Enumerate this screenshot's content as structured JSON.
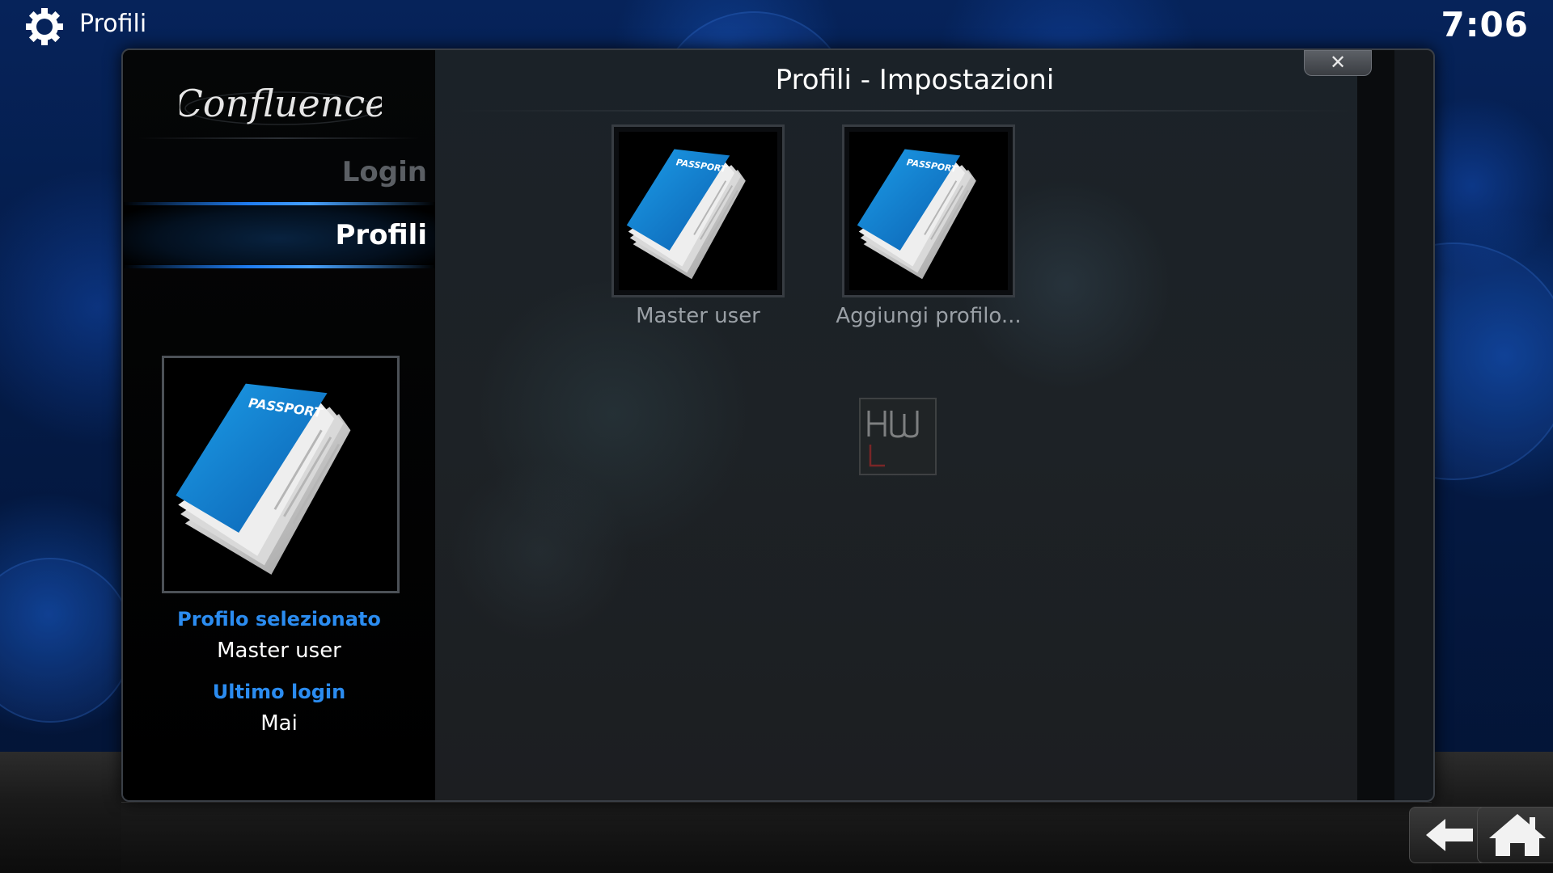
{
  "topbar": {
    "title": "Profili",
    "clock": "7:06",
    "icon": "gear-icon"
  },
  "dialog": {
    "title": "Profili - Impostazioni",
    "close_label": "✕",
    "logo_text": "Confluence"
  },
  "sidebar": {
    "items": [
      {
        "label": "Login",
        "selected": false
      },
      {
        "label": "Profili",
        "selected": true
      }
    ]
  },
  "profile_info": {
    "selected_label": "Profilo selezionato",
    "selected_value": "Master user",
    "last_login_label": "Ultimo login",
    "last_login_value": "Mai"
  },
  "profiles": [
    {
      "name": "Master user",
      "icon": "passport-icon"
    },
    {
      "name": "Aggiungi profilo...",
      "icon": "passport-icon"
    }
  ],
  "passport_text": "PASSPORT",
  "nav": {
    "back_icon": "back-arrow-icon",
    "home_icon": "home-icon"
  },
  "colors": {
    "accent_blue": "#2b8cf0",
    "selection_glow": "#1f7cf0",
    "passport_blue": "#1a8bd8"
  }
}
